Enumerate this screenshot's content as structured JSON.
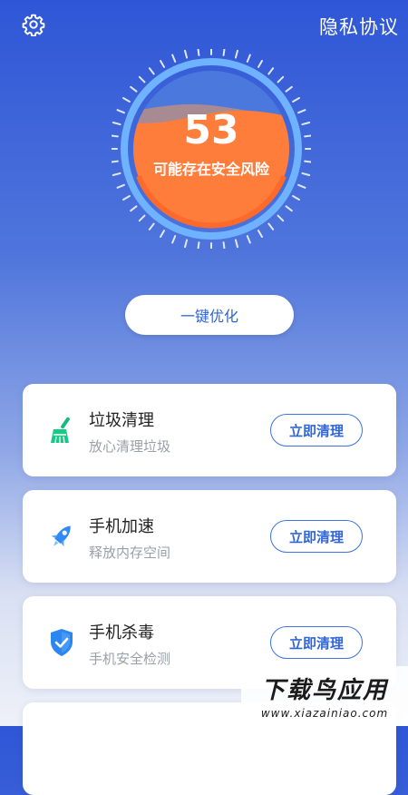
{
  "header": {
    "privacy_label": "隐私协议",
    "settings_icon": "gear-icon"
  },
  "gauge": {
    "score": "53",
    "status": "可能存在安全风险",
    "level": 0.53,
    "colors": {
      "fill": "#ff7d3b",
      "ring": "#6fb2ff"
    }
  },
  "optimize": {
    "label": "一键优化"
  },
  "cards": [
    {
      "title": "垃圾清理",
      "subtitle": "放心清理垃圾",
      "button": "立即清理",
      "icon": "broom-icon"
    },
    {
      "title": "手机加速",
      "subtitle": "释放内存空间",
      "button": "立即清理",
      "icon": "rocket-icon"
    },
    {
      "title": "手机杀毒",
      "subtitle": "手机安全检测",
      "button": "立即清理",
      "icon": "shield-check-icon"
    }
  ],
  "watermark": {
    "line1": "下载鸟应用",
    "line2": "www.xiazainiao.com"
  }
}
